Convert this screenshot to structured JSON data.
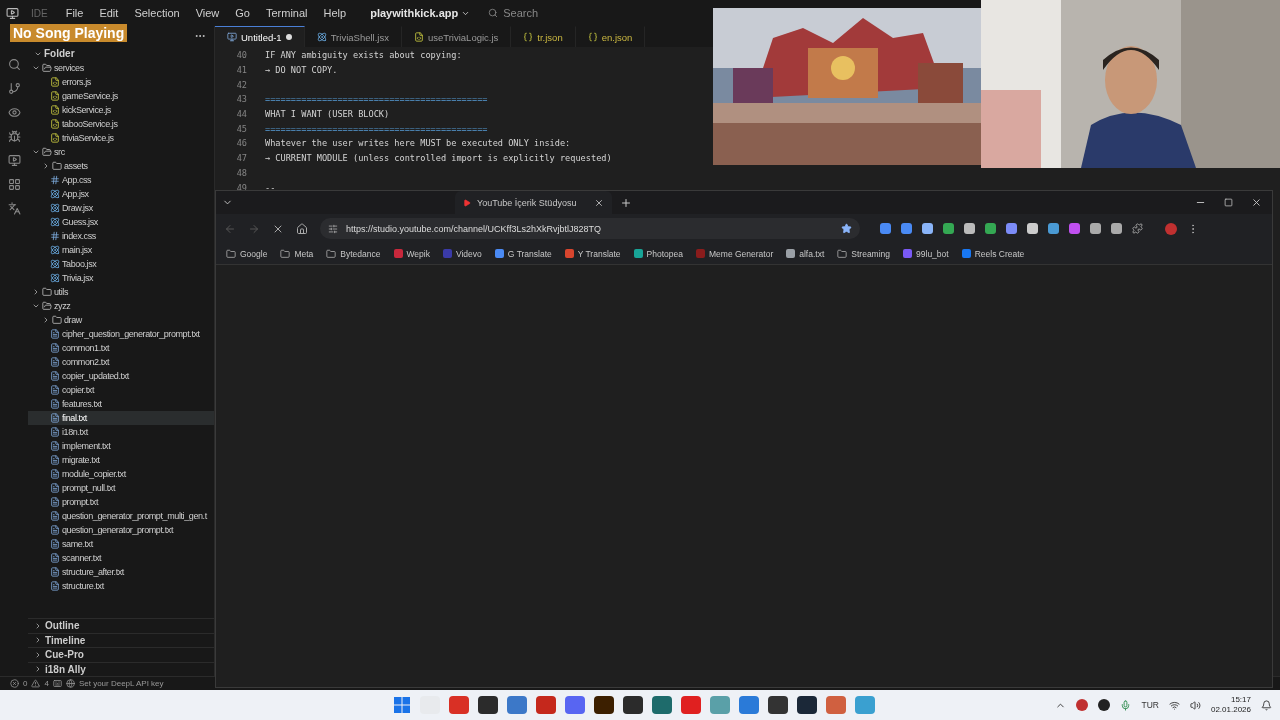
{
  "title_bar": {
    "app": "IDE",
    "menus": [
      "File",
      "Edit",
      "Selection",
      "View",
      "Go",
      "Terminal",
      "Help"
    ],
    "project": "playwithkick.app",
    "search": {
      "placeholder": "Search"
    }
  },
  "overlay": {
    "now_playing": "No Song Playing"
  },
  "sidebar": {
    "section": {
      "label": "Folder",
      "expanded": true
    },
    "tree": [
      {
        "label": "services",
        "kind": "folder",
        "expanded": true,
        "children": [
          {
            "label": "errors.js",
            "kind": "js",
            "selected": false
          },
          {
            "label": "gameService.js",
            "kind": "js",
            "selected": false
          },
          {
            "label": "kickService.js",
            "kind": "js",
            "selected": false
          },
          {
            "label": "tabooService.js",
            "kind": "js",
            "selected": false
          },
          {
            "label": "triviaService.js",
            "kind": "js",
            "selected": false
          }
        ]
      },
      {
        "label": "src",
        "kind": "folder",
        "expanded": true,
        "children": [
          {
            "label": "assets",
            "kind": "folder",
            "expanded": false
          },
          {
            "label": "App.css",
            "kind": "css",
            "selected": false
          },
          {
            "label": "App.jsx",
            "kind": "jsx",
            "selected": false
          },
          {
            "label": "Draw.jsx",
            "kind": "jsx",
            "selected": false
          },
          {
            "label": "Guess.jsx",
            "kind": "jsx",
            "selected": false
          },
          {
            "label": "index.css",
            "kind": "css",
            "selected": false
          },
          {
            "label": "main.jsx",
            "kind": "jsx",
            "selected": false
          },
          {
            "label": "Taboo.jsx",
            "kind": "jsx",
            "selected": false
          },
          {
            "label": "Trivia.jsx",
            "kind": "jsx",
            "selected": false
          }
        ]
      },
      {
        "label": "utils",
        "kind": "folder",
        "expanded": false
      },
      {
        "label": "zyzz",
        "kind": "folder",
        "expanded": true,
        "children": [
          {
            "label": "draw",
            "kind": "folder",
            "expanded": false
          },
          {
            "label": "cipher_question_generator_prompt.txt",
            "kind": "txt",
            "selected": false
          },
          {
            "label": "common1.txt",
            "kind": "txt",
            "selected": false
          },
          {
            "label": "common2.txt",
            "kind": "txt",
            "selected": false
          },
          {
            "label": "copier_updated.txt",
            "kind": "txt",
            "selected": false
          },
          {
            "label": "copier.txt",
            "kind": "txt",
            "selected": false
          },
          {
            "label": "features.txt",
            "kind": "txt",
            "selected": false
          },
          {
            "label": "final.txt",
            "kind": "txt",
            "selected": true
          },
          {
            "label": "i18n.txt",
            "kind": "txt",
            "selected": false
          },
          {
            "label": "implement.txt",
            "kind": "txt",
            "selected": false
          },
          {
            "label": "migrate.txt",
            "kind": "txt",
            "selected": false
          },
          {
            "label": "module_copier.txt",
            "kind": "txt",
            "selected": false
          },
          {
            "label": "prompt_null.txt",
            "kind": "txt",
            "selected": false
          },
          {
            "label": "prompt.txt",
            "kind": "txt",
            "selected": false
          },
          {
            "label": "question_generator_prompt_multi_gen.t",
            "kind": "txt",
            "selected": false
          },
          {
            "label": "question_generator_prompt.txt",
            "kind": "txt",
            "selected": false
          },
          {
            "label": "same.txt",
            "kind": "txt",
            "selected": false
          },
          {
            "label": "scanner.txt",
            "kind": "txt",
            "selected": false
          },
          {
            "label": "structure_after.txt",
            "kind": "txt",
            "selected": false
          },
          {
            "label": "structure.txt",
            "kind": "txt",
            "selected": false
          }
        ]
      }
    ],
    "panes": [
      {
        "label": "Outline",
        "expanded": false
      },
      {
        "label": "Timeline",
        "expanded": false
      },
      {
        "label": "Cue-Pro",
        "expanded": false
      },
      {
        "label": "i18n Ally",
        "expanded": false
      }
    ]
  },
  "editor": {
    "tabs": [
      {
        "label": "Untitled-1",
        "kind": "text",
        "selected": true,
        "modified": true
      },
      {
        "label": "TriviaShell.jsx",
        "kind": "jsx",
        "selected": false,
        "modified": false
      },
      {
        "label": "useTriviaLogic.js",
        "kind": "js",
        "selected": false,
        "modified": false
      },
      {
        "label": "tr.json",
        "kind": "json",
        "selected": false,
        "modified": false
      },
      {
        "label": "en.json",
        "kind": "json",
        "selected": false,
        "modified": false
      }
    ],
    "lines": [
      {
        "number": "40",
        "kind": "text",
        "text": "IF ANY ambiguity exists about copying:"
      },
      {
        "number": "41",
        "kind": "text",
        "text": "→ DO NOT COPY."
      },
      {
        "number": "42"
      },
      {
        "number": "43",
        "kind": "rule",
        "text": "==========================================="
      },
      {
        "number": "44",
        "kind": "text",
        "text": "WHAT I WANT (USER BLOCK)"
      },
      {
        "number": "45",
        "kind": "rule",
        "text": "==========================================="
      },
      {
        "number": "46",
        "kind": "text",
        "text": "Whatever the user writes here MUST be executed ONLY inside:"
      },
      {
        "number": "47",
        "kind": "text",
        "text": "→ CURRENT MODULE (unless controlled import is explicitly requested)"
      },
      {
        "number": "48"
      },
      {
        "number": "49",
        "kind": "text",
        "text": "--"
      }
    ]
  },
  "status_bar": {
    "errors": "0",
    "warnings": "4",
    "message": "Set your DeepL API key"
  },
  "browser": {
    "tab": {
      "title": "YouTube İçerik Stüdyosu"
    },
    "url": "https://studio.youtube.com/channel/UCKff3Ls2hXkRvjbtlJ828TQ",
    "loading": true,
    "bookmarks": [
      {
        "label": "Google",
        "kind": "folder"
      },
      {
        "label": "Meta",
        "kind": "folder"
      },
      {
        "label": "Bytedance",
        "kind": "folder"
      },
      {
        "label": "Wepik",
        "kind": "site",
        "color": "#c8283c"
      },
      {
        "label": "Videvo",
        "kind": "site",
        "color": "#3a3aa8"
      },
      {
        "label": "G Translate",
        "kind": "site",
        "color": "#4a8af4"
      },
      {
        "label": "Y Translate",
        "kind": "site",
        "color": "#d8452e"
      },
      {
        "label": "Photopea",
        "kind": "site",
        "color": "#18a497"
      },
      {
        "label": "Meme Generator",
        "kind": "site",
        "color": "#8a1c1c"
      },
      {
        "label": "alfa.txt",
        "kind": "site",
        "color": "#9aa0a6"
      },
      {
        "label": "Streaming",
        "kind": "folder"
      },
      {
        "label": "99lu_bot",
        "kind": "site",
        "color": "#7a5af5"
      },
      {
        "label": "Reels Create",
        "kind": "site",
        "color": "#1877f2"
      }
    ]
  },
  "taskbar": {
    "language": "TUR",
    "time": "15:17",
    "date": "02.01.2026"
  }
}
